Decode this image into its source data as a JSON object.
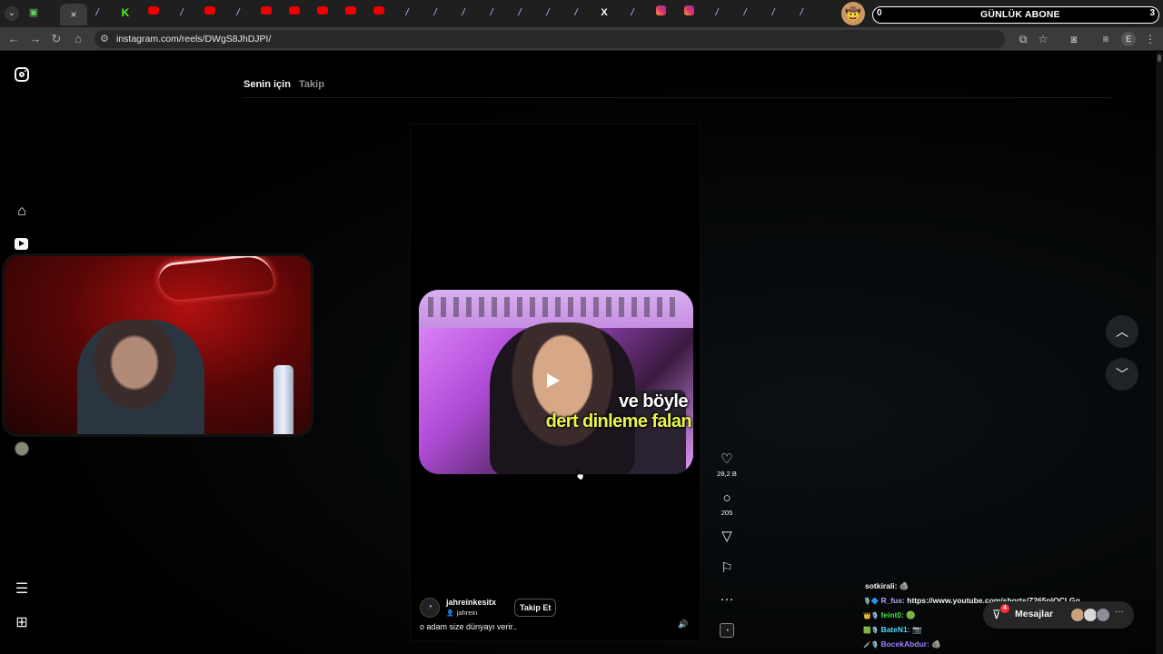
{
  "browser": {
    "url": "instagram.com/reels/DWgS8JhDJPI/",
    "tabs": [
      "green",
      "active",
      "feather",
      "k",
      "yt",
      "feather",
      "yt",
      "feather",
      "yt",
      "yt",
      "yt",
      "yt",
      "yt",
      "feather",
      "feather",
      "feather",
      "feather",
      "feather",
      "feather",
      "feather",
      "x",
      "feather",
      "ig",
      "ig",
      "feather",
      "feather",
      "feather",
      "feather",
      "yt"
    ],
    "active_tab_close": "×"
  },
  "stream_overlay": {
    "sub_goal_title": "GÜNLÜK ABONE",
    "sub_goal_current": "0",
    "sub_goal_target": "3"
  },
  "feed": {
    "tab_for_you": "Senin için",
    "tab_following": "Takip"
  },
  "reel": {
    "overlay_line1": "ve böyle",
    "overlay_line2": "dert dinleme falan",
    "author_username": "jahreinkesitx",
    "author_subname": "jahrein",
    "follow_label": "Takip Et",
    "caption": "o adam size dünyayı verir..",
    "likes": "28,2 B",
    "comments": "205"
  },
  "chat": [
    {
      "badges": "",
      "user": "sotkirali:",
      "user_color": "#f5f5f5",
      "msg": "🪨"
    },
    {
      "badges": "🎙️🔷",
      "user": "R_fus:",
      "user_color": "#b6a7ff",
      "msg": "https://www.youtube.com/shorts/Z265plQCLGg"
    },
    {
      "badges": "👑🎙️",
      "user": "feint0:",
      "user_color": "#4ddf4d",
      "msg": "🟢"
    },
    {
      "badges": "🟩🎙️",
      "user": "BateN1:",
      "user_color": "#52d6ff",
      "msg": "📷"
    },
    {
      "badges": "🗡️🎙️",
      "user": "BocekAbdur:",
      "user_color": "#a080ff",
      "msg": "🪨"
    }
  ],
  "messages": {
    "label": "Mesajlar",
    "unread": "4"
  },
  "colors": {
    "background": "#000000",
    "unread_badge": "#ff3040",
    "caption_yellow": "#e8f54a"
  },
  "icons": [
    "instagram-icon",
    "home-icon",
    "reels-icon",
    "menu-icon",
    "apps-icon",
    "heart-icon",
    "comment-icon",
    "share-icon",
    "bookmark-icon",
    "more-icon",
    "chevron-up-icon",
    "chevron-down-icon"
  ]
}
